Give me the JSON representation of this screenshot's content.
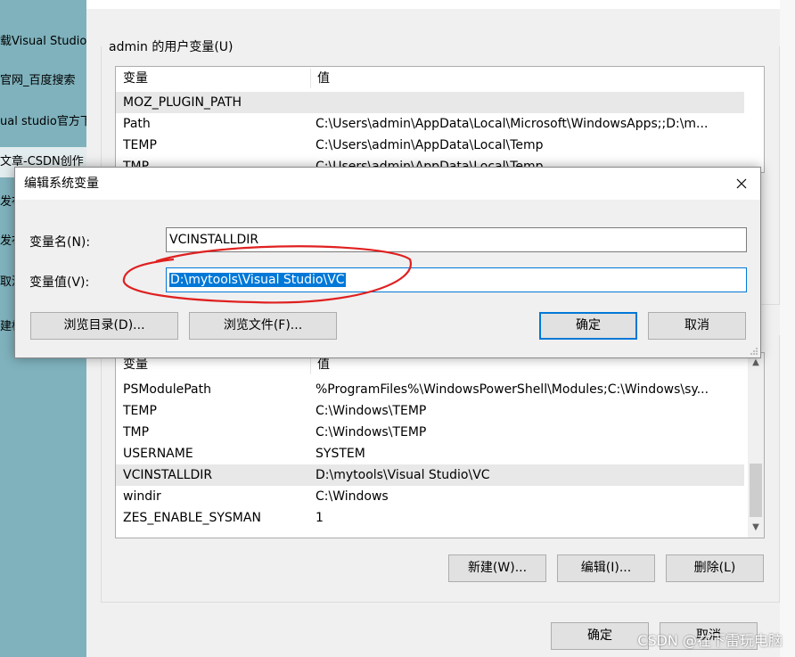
{
  "browser_tabs": [
    {
      "label": "载Visual Studio教"
    },
    {
      "label": "官网_百度搜索"
    },
    {
      "label": "ual studio官方下"
    },
    {
      "label": "文章-CSDN创作"
    },
    {
      "label": "发布"
    },
    {
      "label": "发布"
    },
    {
      "label": "取消"
    },
    {
      "label": "建标"
    }
  ],
  "env_dialog": {
    "user_group_title": "admin 的用户变量(U)",
    "column_variable": "变量",
    "column_value": "值",
    "user_vars": [
      {
        "name": "MOZ_PLUGIN_PATH",
        "value": ""
      },
      {
        "name": "Path",
        "value": "C:\\Users\\admin\\AppData\\Local\\Microsoft\\WindowsApps;;D:\\m..."
      },
      {
        "name": "TEMP",
        "value": "C:\\Users\\admin\\AppData\\Local\\Temp"
      },
      {
        "name": "TMP",
        "value": "C:\\Users\\admin\\AppData\\Local\\Temp"
      }
    ],
    "system_vars": [
      {
        "name": "PSModulePath",
        "value": "%ProgramFiles%\\WindowsPowerShell\\Modules;C:\\Windows\\sy..."
      },
      {
        "name": "TEMP",
        "value": "C:\\Windows\\TEMP"
      },
      {
        "name": "TMP",
        "value": "C:\\Windows\\TEMP"
      },
      {
        "name": "USERNAME",
        "value": "SYSTEM"
      },
      {
        "name": "VCINSTALLDIR",
        "value": "D:\\mytools\\Visual Studio\\VC"
      },
      {
        "name": "windir",
        "value": "C:\\Windows"
      },
      {
        "name": "ZES_ENABLE_SYSMAN",
        "value": "1"
      }
    ],
    "new_button": "新建(W)...",
    "edit_button": "编辑(I)...",
    "delete_button": "删除(L)",
    "ok_button": "确定",
    "cancel_button": "取消"
  },
  "edit_dialog": {
    "title": "编辑系统变量",
    "name_label": "变量名(N):",
    "name_value": "VCINSTALLDIR",
    "value_label": "变量值(V):",
    "value_value": "D:\\mytools\\Visual Studio\\VC",
    "browse_dir_button": "浏览目录(D)...",
    "browse_file_button": "浏览文件(F)...",
    "ok_button": "确定",
    "cancel_button": "取消"
  },
  "watermark": "CSDN @在下雷玩电脑",
  "colors": {
    "accent": "#0078d7",
    "annotation": "#e02020",
    "desktop": "#7fb2bd"
  }
}
